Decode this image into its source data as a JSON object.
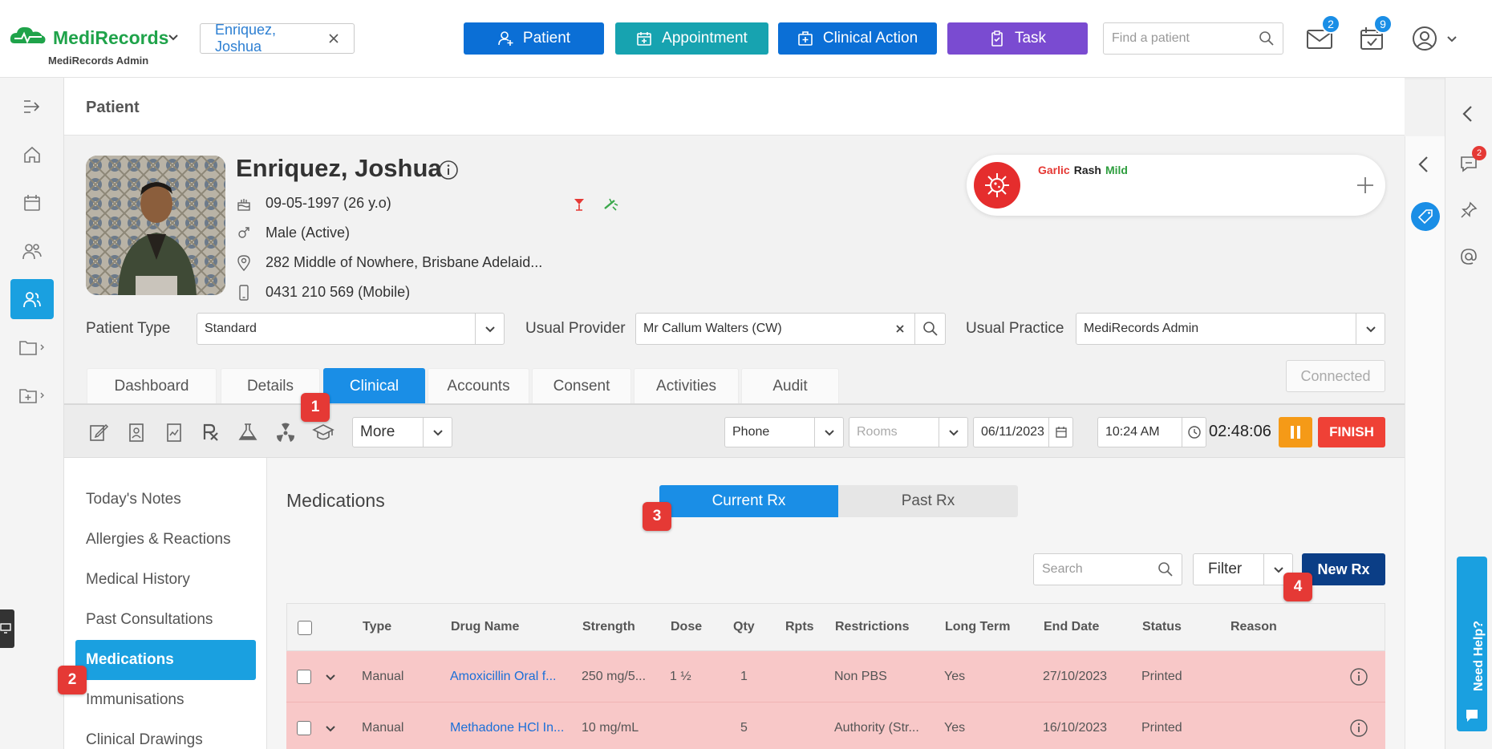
{
  "header": {
    "app_name": "MediRecords",
    "app_subtitle": "MediRecords Admin",
    "open_patient_tab": "Enriquez, Joshua",
    "buttons": [
      {
        "label": "Patient",
        "color": "#0b6fd6"
      },
      {
        "label": "Appointment",
        "color": "#17a3b0"
      },
      {
        "label": "Clinical Action",
        "color": "#0b6fd6"
      },
      {
        "label": "Task",
        "color": "#7a4bd1"
      }
    ],
    "find_patient_placeholder": "Find a patient",
    "mail_count": "2",
    "tasks_count": "9"
  },
  "page": {
    "title": "Patient"
  },
  "patient": {
    "name": "Enriquez, Joshua",
    "dob": "09-05-1997 (26 y.o)",
    "gender": "Male (Active)",
    "address": "282 Middle of Nowhere, Brisbane Adelaid...",
    "phone": "0431 210 569 (Mobile)"
  },
  "allergy": {
    "substance": "Garlic",
    "reaction": "Rash",
    "severity": "Mild"
  },
  "fields": {
    "patient_type_label": "Patient Type",
    "patient_type_value": "Standard",
    "usual_provider_label": "Usual Provider",
    "usual_provider_value": "Mr Callum Walters (CW)",
    "usual_practice_label": "Usual Practice",
    "usual_practice_value": "MediRecords Admin"
  },
  "tabs": [
    "Dashboard",
    "Details",
    "Clinical",
    "Accounts",
    "Consent",
    "Activities",
    "Audit"
  ],
  "active_tab": "Clinical",
  "connected_label": "Connected",
  "toolbar": {
    "more_label": "More",
    "channel": "Phone",
    "rooms_placeholder": "Rooms",
    "date": "06/11/2023",
    "time": "10:24 AM",
    "timer": "02:48:06",
    "finish_label": "FINISH"
  },
  "steps": [
    "1",
    "2",
    "3",
    "4"
  ],
  "side_menu": [
    "Today's Notes",
    "Allergies & Reactions",
    "Medical History",
    "Past Consultations",
    "Medications",
    "Immunisations",
    "Clinical Drawings"
  ],
  "side_menu_active": "Medications",
  "medications": {
    "title": "Medications",
    "segments": [
      "Current Rx",
      "Past Rx"
    ],
    "search_placeholder": "Search",
    "filter_label": "Filter",
    "new_rx_label": "New Rx",
    "columns": [
      "Type",
      "Drug Name",
      "Strength",
      "Dose",
      "Qty",
      "Rpts",
      "Restrictions",
      "Long Term",
      "End Date",
      "Status",
      "Reason"
    ],
    "rows": [
      {
        "type": "Manual",
        "drug": "Amoxicillin Oral f...",
        "strength": "250 mg/5...",
        "dose": "1 ½",
        "qty": "1",
        "rpts": "",
        "restrictions": "Non PBS",
        "long_term": "Yes",
        "end_date": "27/10/2023",
        "status": "Printed",
        "reason": ""
      },
      {
        "type": "Manual",
        "drug": "Methadone HCl In...",
        "strength": "10 mg/mL",
        "dose": "",
        "qty": "5",
        "rpts": "",
        "restrictions": "Authority (Str...",
        "long_term": "Yes",
        "end_date": "16/10/2023",
        "status": "Printed",
        "reason": ""
      }
    ]
  },
  "right_rail": {
    "chat_badge": "2",
    "need_help_label": "Need Help?"
  }
}
